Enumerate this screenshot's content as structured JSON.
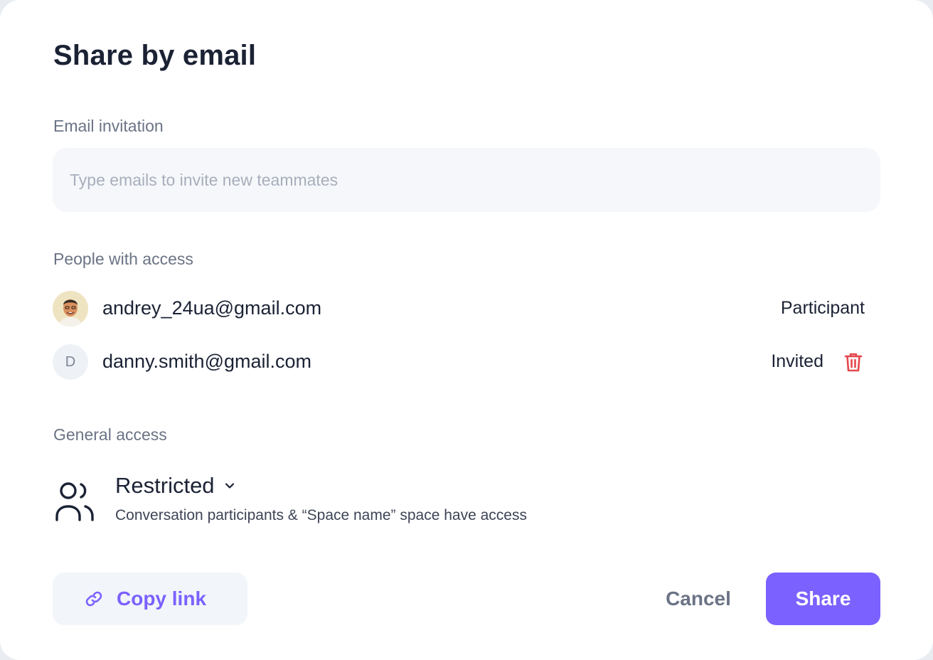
{
  "dialog": {
    "title": "Share by email"
  },
  "email_invitation": {
    "label": "Email invitation",
    "value": "",
    "placeholder": "Type emails to invite new teammates"
  },
  "people_with_access": {
    "label": "People with access",
    "people": [
      {
        "email": "andrey_24ua@gmail.com",
        "role": "Participant",
        "avatar": "photo"
      },
      {
        "email": "danny.smith@gmail.com",
        "role": "Invited",
        "avatar_initial": "D",
        "removable": true
      }
    ]
  },
  "general_access": {
    "label": "General access",
    "level": "Restricted",
    "description": "Conversation participants & “Space name” space have access",
    "icon": "people-icon"
  },
  "actions": {
    "copy_link": "Copy link",
    "cancel": "Cancel",
    "share": "Share"
  },
  "colors": {
    "accent": "#7b61ff",
    "danger": "#e5484d",
    "text_primary": "#1b2234",
    "text_secondary": "#6b7385"
  }
}
